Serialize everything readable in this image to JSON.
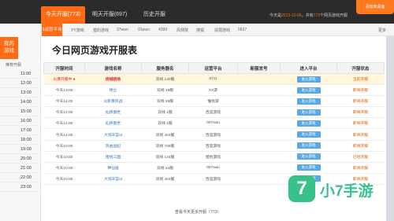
{
  "header": {
    "tabs": [
      {
        "label": "今天开服",
        "count": "(773)"
      },
      {
        "label": "明天开服",
        "count": "(697)"
      },
      {
        "label": "历史开服",
        "count": ""
      }
    ],
    "today_prefix": "今天是",
    "today_date": "2013-12-06",
    "today_mid": "，共有",
    "today_count": "773",
    "today_suffix": "个网页游戏开服",
    "corner_button": "添加到桌面"
  },
  "platform_bar": {
    "lead": "1运营平台",
    "items": [
      "YY游戏",
      "猎豹游戏",
      "37wan",
      "91wan",
      "4399",
      "风林院",
      "搜狐",
      "扶弱游戏",
      "6637"
    ],
    "more": "更多"
  },
  "sidebar": {
    "logo_line1": "我的",
    "logo_line2": "游戏",
    "title": "推荐开服",
    "times": [
      "11:00",
      "12:00",
      "13:00",
      "14:00",
      "15:00",
      "16:00",
      "17:00",
      "18:00",
      "19:00",
      "20:00",
      "21:00",
      "22:00",
      "23:00"
    ]
  },
  "main": {
    "title": "今日网页游戏开服表",
    "columns": [
      "开服时间",
      "游戏名称",
      "服务器名",
      "运营平台",
      "新服发号",
      "进入平台",
      "开服状态"
    ],
    "rows": [
      {
        "time": "火爆开服中",
        "game": "烧城烧地",
        "server": "双线 140服",
        "platform": "6711",
        "gift": "",
        "enter": "进入游戏",
        "status": "当前开服",
        "hot": true
      },
      {
        "time": "今天13:00",
        "game": "绝尘",
        "server": "双线 19服",
        "platform": "XX游",
        "gift": "",
        "enter": "进入游戏",
        "status": "即将开服",
        "hot": false
      },
      {
        "time": "今天14:00",
        "game": "火影疾风战",
        "server": "双线 59服",
        "platform": "懂找游",
        "gift": "",
        "enter": "进入游戏",
        "status": "即将开服",
        "hot": false
      },
      {
        "time": "今天14:00",
        "game": "仙侠傲世",
        "server": "双线 1服",
        "platform": "百度游戏",
        "gift": "",
        "enter": "进入游戏",
        "status": "即将开服",
        "hot": false
      },
      {
        "time": "今天14:00",
        "game": "仙侠傲世",
        "server": "双线 1服",
        "platform": "007wan",
        "gift": "",
        "enter": "进入游戏",
        "status": "即将开服",
        "hot": false
      },
      {
        "time": "今天14:00",
        "game": "大闹天宫ol",
        "server": "双线 403服",
        "platform": "百度游戏",
        "gift": "",
        "enter": "进入游戏",
        "status": "即将开服",
        "hot": false
      },
      {
        "time": "今天10:00",
        "game": "热血战纪",
        "server": "双线 709服",
        "platform": "百度游戏",
        "gift": "",
        "enter": "进入游戏",
        "status": "即将开服",
        "hot": false
      },
      {
        "time": "今天10:00",
        "game": "街机三国",
        "server": "双线 134服",
        "platform": "猎豹游戏",
        "gift": "",
        "enter": "进入游戏",
        "status": "已经开服",
        "hot": false
      },
      {
        "time": "今天10:00",
        "game": "神仙道",
        "server": "双线 34服",
        "platform": "007wan",
        "gift": "",
        "enter": "进入游戏",
        "status": "即将开服",
        "hot": false
      },
      {
        "time": "今天10:00",
        "game": "大闹天宫ol",
        "server": "双线 403服",
        "platform": "百度游戏",
        "gift": "",
        "enter": "进入游戏",
        "status": "即将开服",
        "hot": false
      }
    ],
    "footer_link": "查看今天更多开服（773）"
  },
  "watermark": {
    "badge": "7",
    "text": "小7手游"
  },
  "colors": {
    "accent": "#ff6a13",
    "link": "#2f6fb7",
    "button": "#5aa9e6",
    "hot_row": "#fff6dc",
    "watermark": "#39c18a"
  }
}
